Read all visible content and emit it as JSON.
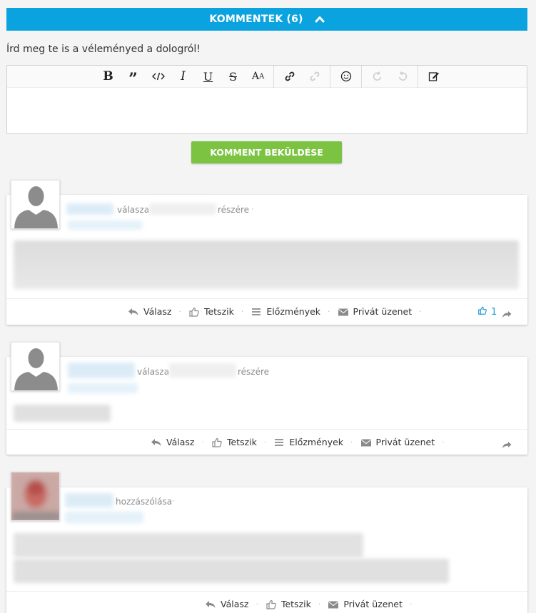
{
  "comments_section": {
    "title": "KOMMENTEK (6)",
    "prompt": "Írd meg te is a véleményed a dologról!",
    "submit_label": "KOMMENT BEKÜLDÉSE"
  },
  "toolbar": {
    "buttons": [
      "bold-icon",
      "quote-icon",
      "code-icon",
      "italic-icon",
      "underline-icon",
      "strikethrough-icon",
      "font-size-icon",
      "link-icon",
      "unlink-icon",
      "emoji-icon",
      "undo-icon",
      "redo-icon",
      "edit-icon"
    ]
  },
  "comments": [
    {
      "type_text": "válasza",
      "target_text": "részére",
      "actions": {
        "reply": "Válasz",
        "like": "Tetszik",
        "history": "Előzmények",
        "private": "Privát üzenet"
      },
      "like_count": "1"
    },
    {
      "type_text": "válasza",
      "target_text": "részére",
      "actions": {
        "reply": "Válasz",
        "like": "Tetszik",
        "history": "Előzmények",
        "private": "Privát üzenet"
      }
    },
    {
      "type_text": "hozzászólása",
      "actions": {
        "reply": "Válasz",
        "like": "Tetszik",
        "private": "Privát üzenet"
      }
    }
  ],
  "colors": {
    "header": "#0aa3e0",
    "submit": "#7cc342",
    "like_blue": "#1c9bd8"
  }
}
